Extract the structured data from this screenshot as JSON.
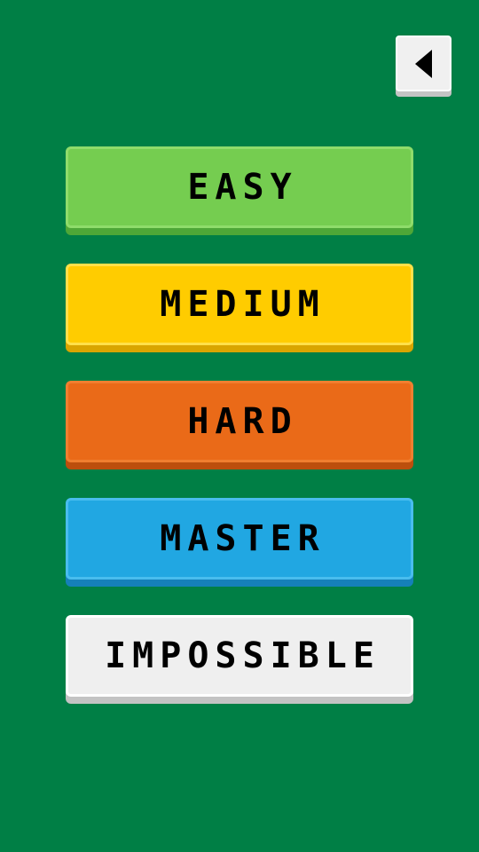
{
  "header": {
    "back_icon": "back-arrow-icon"
  },
  "levels": [
    {
      "label": "EASY",
      "color": "#75cd50"
    },
    {
      "label": "MEDIUM",
      "color": "#ffcc00"
    },
    {
      "label": "HARD",
      "color": "#ea6a18"
    },
    {
      "label": "MASTER",
      "color": "#21a7e2"
    },
    {
      "label": "IMPOSSIBLE",
      "color": "#efefef"
    }
  ],
  "colors": {
    "background": "#007f45"
  }
}
